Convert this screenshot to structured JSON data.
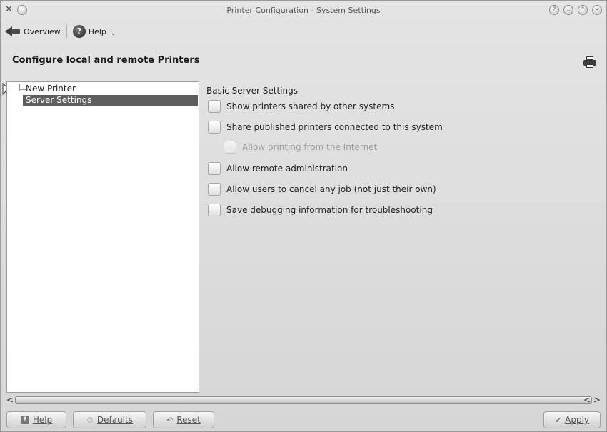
{
  "window": {
    "title": "Printer Configuration - System Settings",
    "titlebar_buttons": [
      "help-button",
      "minimize-button",
      "maximize-button",
      "close-button"
    ]
  },
  "toolbar": {
    "overview_label": "Overview",
    "help_label": "Help"
  },
  "header": {
    "title": "Configure local and remote Printers"
  },
  "tree": {
    "items": [
      {
        "label": "New Printer",
        "selected": false
      },
      {
        "label": "Server Settings",
        "selected": true
      }
    ]
  },
  "settings": {
    "section_title": "Basic Server Settings",
    "options": [
      {
        "label": "Show printers shared by other systems",
        "checked": false,
        "enabled": true
      },
      {
        "label": "Share published printers connected to this system",
        "checked": false,
        "enabled": true
      },
      {
        "label": "Allow printing from the Internet",
        "checked": false,
        "enabled": false
      },
      {
        "label": "Allow remote administration",
        "checked": false,
        "enabled": true
      },
      {
        "label": "Allow users to cancel any job (not just their own)",
        "checked": false,
        "enabled": true
      },
      {
        "label": "Save debugging information for troubleshooting",
        "checked": false,
        "enabled": true
      }
    ]
  },
  "buttons": {
    "help": "Help",
    "defaults": "Defaults",
    "reset": "Reset",
    "apply": "Apply"
  },
  "scrollbar": {
    "left_arrow": "<",
    "right_arrow": "< >"
  },
  "colors": {
    "selection": "#5e5e5e",
    "window_bg": "#dcdcdc"
  }
}
